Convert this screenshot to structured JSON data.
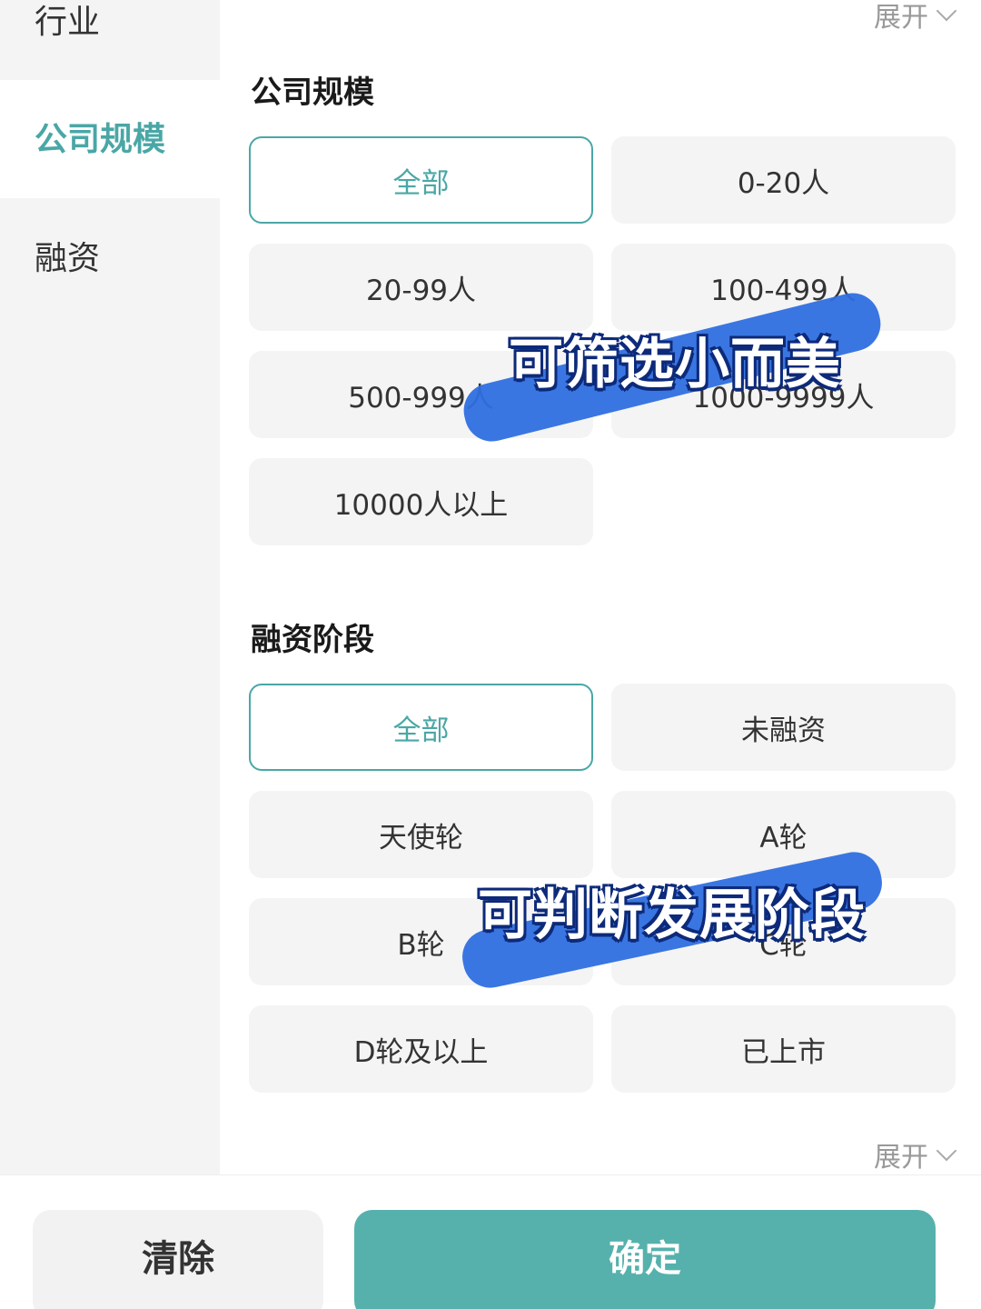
{
  "sidebar": {
    "items": [
      {
        "label": "行业",
        "active": false
      },
      {
        "label": "公司规模",
        "active": true
      },
      {
        "label": "融资",
        "active": false
      }
    ]
  },
  "company_size": {
    "expand_label": "展开",
    "title": "公司规模",
    "options": [
      {
        "label": "全部",
        "selected": true
      },
      {
        "label": "0-20人",
        "selected": false
      },
      {
        "label": "20-99人",
        "selected": false
      },
      {
        "label": "100-499人",
        "selected": false
      },
      {
        "label": "500-999人",
        "selected": false
      },
      {
        "label": "1000-9999人",
        "selected": false
      },
      {
        "label": "10000人以上",
        "selected": false
      }
    ]
  },
  "financing": {
    "title": "融资阶段",
    "expand_label": "展开",
    "options": [
      {
        "label": "全部",
        "selected": true
      },
      {
        "label": "未融资",
        "selected": false
      },
      {
        "label": "天使轮",
        "selected": false
      },
      {
        "label": "A轮",
        "selected": false
      },
      {
        "label": "B轮",
        "selected": false
      },
      {
        "label": "C轮",
        "selected": false
      },
      {
        "label": "D轮及以上",
        "selected": false
      },
      {
        "label": "已上市",
        "selected": false
      }
    ]
  },
  "footer": {
    "clear_label": "清除",
    "confirm_label": "确定"
  },
  "overlays": {
    "caption_1": "可筛选小而美",
    "caption_2": "可判断发展阶段"
  },
  "colors": {
    "accent": "#4aa7a6",
    "confirm_bg": "#56b1ad",
    "brush": "#2f6fe0"
  }
}
